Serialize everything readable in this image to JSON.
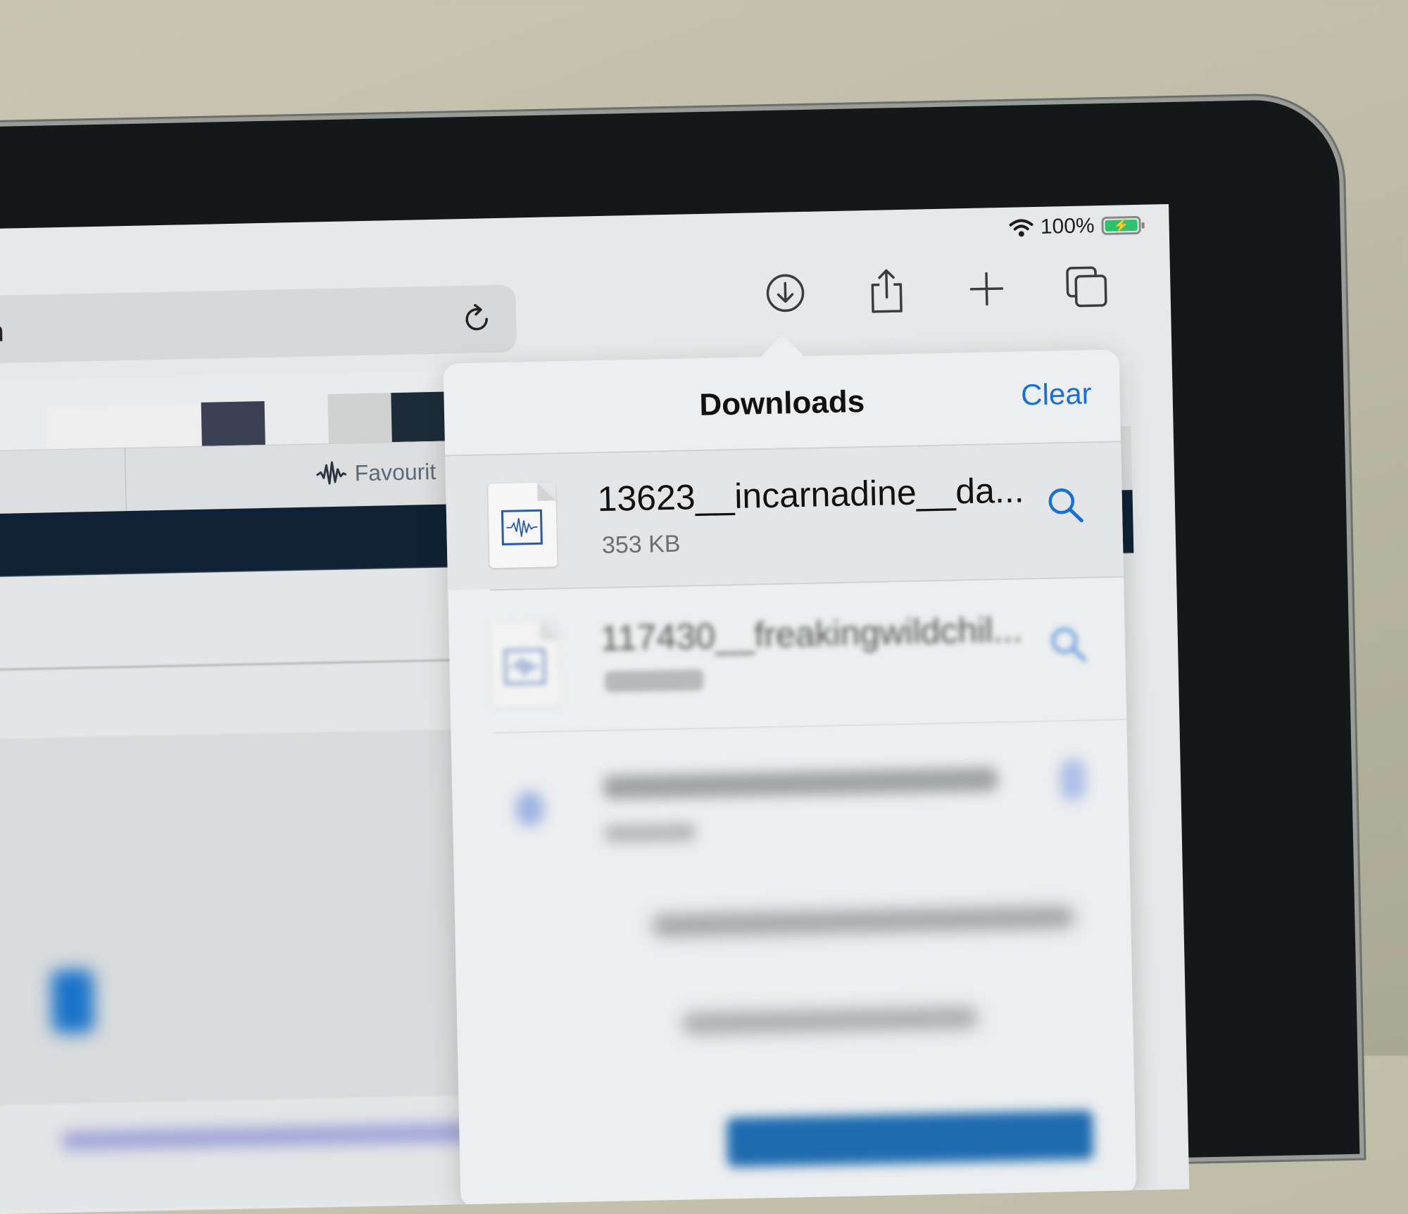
{
  "status_bar": {
    "wifi_icon": "wifi-icon",
    "battery_percent": "100%",
    "battery_icon": "battery-charging-icon",
    "battery_color": "#2bc36b"
  },
  "toolbar": {
    "url_fragment": "n",
    "reload_icon": "reload-icon",
    "downloads_icon": "downloads-icon",
    "share_icon": "share-icon",
    "new_tab_icon": "plus-icon",
    "tabs_icon": "tabs-overview-icon"
  },
  "favourites_bar": {
    "item_label": "Favourit",
    "item_icon": "waveform-icon"
  },
  "downloads_popover": {
    "title": "Downloads",
    "clear_label": "Clear",
    "accent_color": "#1a6fd0",
    "items": [
      {
        "name": "13623__incarnadine__da...",
        "size": "353 KB",
        "file_icon": "audio-file-icon",
        "action_icon": "search-icon"
      },
      {
        "name": "117430__freakingwildchil...",
        "size": "",
        "file_icon": "audio-file-icon",
        "action_icon": "search-icon"
      },
      {
        "name": "",
        "size": "",
        "file_icon": "audio-file-icon",
        "action_icon": "search-icon"
      }
    ]
  }
}
